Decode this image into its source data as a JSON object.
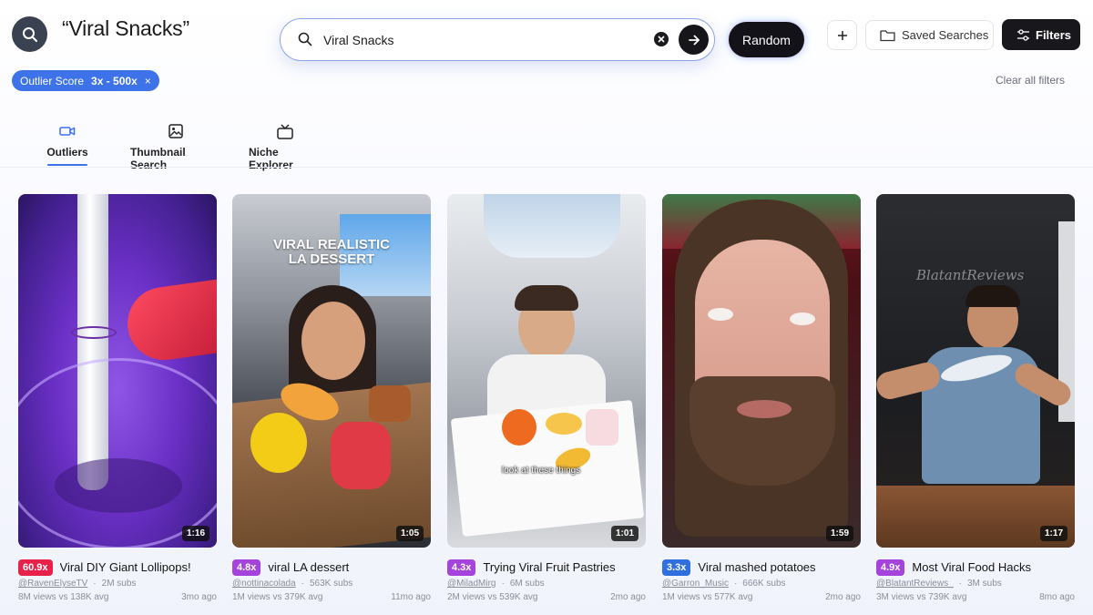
{
  "header": {
    "title": "“Viral Snacks”",
    "search_value": "Viral Snacks",
    "random_label": "Random",
    "saved_searches_label": "Saved Searches",
    "filters_label": "Filters",
    "clear_all_label": "Clear all filters"
  },
  "filter_chip": {
    "label": "Outlier Score",
    "value": "3x - 500x",
    "remove": "×"
  },
  "tabs": [
    {
      "label": "Outliers",
      "icon": "video-camera-icon",
      "active": true
    },
    {
      "label": "Thumbnail Search",
      "icon": "image-icon",
      "active": false
    },
    {
      "label": "Niche Explorer",
      "icon": "tv-icon",
      "active": false
    }
  ],
  "colors": {
    "accent": "#3d72e8",
    "badge_red": "#e8214a",
    "badge_purple": "#a444dd",
    "badge_blue": "#2f6fe0"
  },
  "videos": [
    {
      "score": "60.9x",
      "badge_color": "#e8214a",
      "title": "Viral DIY Giant Lollipops!",
      "channel": "@RavenElyseTV",
      "subs": "2M subs",
      "views": "8M views vs 138K avg",
      "age": "3mo ago",
      "duration": "1:16"
    },
    {
      "score": "4.8x",
      "badge_color": "#a444dd",
      "title": "viral LA dessert",
      "channel": "@nottinacolada",
      "subs": "563K subs",
      "views": "1M views vs 379K avg",
      "age": "11mo ago",
      "duration": "1:05",
      "overlay": [
        "VIRAL REALISTIC",
        "LA DESSERT"
      ]
    },
    {
      "score": "4.3x",
      "badge_color": "#a444dd",
      "title": "Trying Viral Fruit Pastries",
      "channel": "@MiladMirg",
      "subs": "6M subs",
      "views": "2M views vs 539K avg",
      "age": "2mo ago",
      "duration": "1:01",
      "caption": "look at these things"
    },
    {
      "score": "3.3x",
      "badge_color": "#2f6fe0",
      "title": "Viral mashed potatoes",
      "channel": "@Garron_Music",
      "subs": "666K subs",
      "views": "1M views vs 577K avg",
      "age": "2mo ago",
      "duration": "1:59"
    },
    {
      "score": "4.9x",
      "badge_color": "#a444dd",
      "title": "Most Viral Food Hacks",
      "channel": "@BlatantReviews_",
      "subs": "3M subs",
      "views": "3M views vs 739K avg",
      "age": "8mo ago",
      "duration": "1:17",
      "watermark": "BlatantReviews"
    }
  ]
}
